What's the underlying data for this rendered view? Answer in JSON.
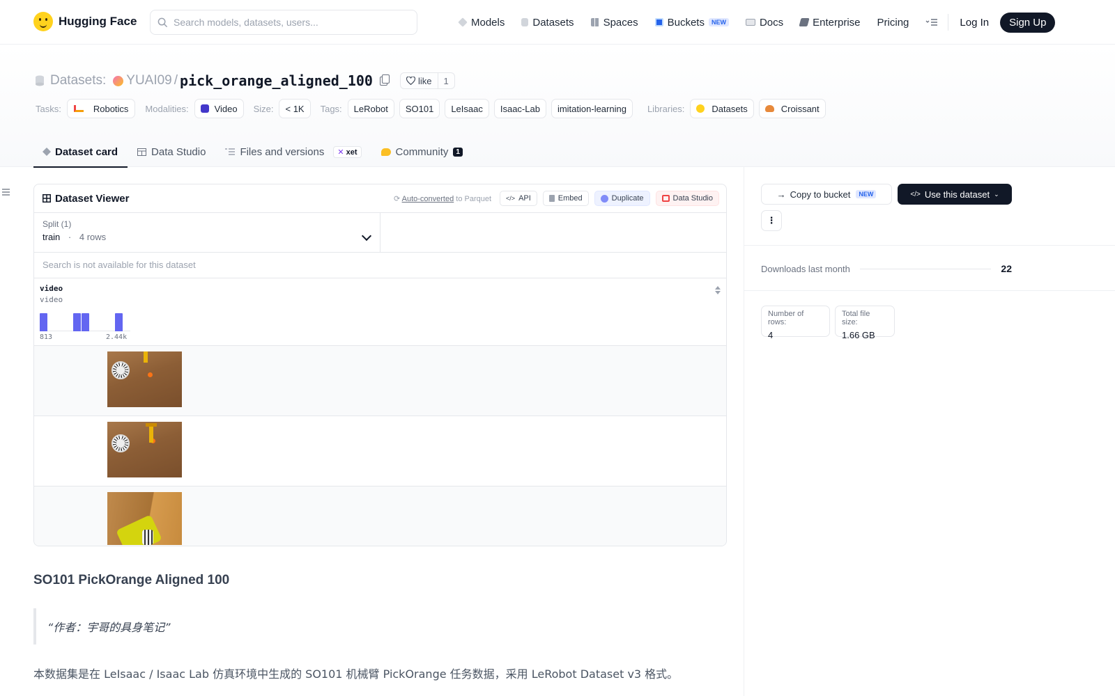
{
  "nav": {
    "brand": "Hugging Face",
    "search_placeholder": "Search models, datasets, users...",
    "links": [
      {
        "label": "Models",
        "icon": "cube-icon",
        "color": "#9ca3af"
      },
      {
        "label": "Datasets",
        "icon": "database-icon",
        "color": "#9ca3af"
      },
      {
        "label": "Spaces",
        "icon": "grid-icon",
        "color": "#9ca3af"
      },
      {
        "label": "Buckets",
        "icon": "bucket-icon",
        "color": "#2563eb",
        "badge": "NEW"
      },
      {
        "label": "Docs",
        "icon": "book-icon",
        "color": "#9ca3af"
      },
      {
        "label": "Enterprise",
        "icon": "enterprise-icon",
        "color": "#374151"
      },
      {
        "label": "Pricing"
      }
    ],
    "login": "Log In",
    "signup": "Sign Up"
  },
  "repo": {
    "type_label": "Datasets:",
    "owner": "YUAI09",
    "separator": "/",
    "name": "pick_orange_aligned_100",
    "like_label": "like",
    "like_count": "1"
  },
  "tags": {
    "tasks_label": "Tasks:",
    "tasks": [
      "Robotics"
    ],
    "modalities_label": "Modalities:",
    "modalities": [
      "Video"
    ],
    "size_label": "Size:",
    "size": [
      "< 1K"
    ],
    "tags_label": "Tags:",
    "tags": [
      "LeRobot",
      "SO101",
      "LeIsaac",
      "Isaac-Lab",
      "imitation-learning"
    ],
    "libraries_label": "Libraries:",
    "libraries": [
      "Datasets",
      "Croissant"
    ]
  },
  "tabs": [
    {
      "label": "Dataset card",
      "active": true
    },
    {
      "label": "Data Studio"
    },
    {
      "label": "Files and versions",
      "badge": "xet"
    },
    {
      "label": "Community",
      "count": "1"
    }
  ],
  "viewer": {
    "title": "Dataset Viewer",
    "auto_converted": "Auto-converted",
    "to_parquet": "to Parquet",
    "buttons": [
      "API",
      "Embed",
      "Duplicate",
      "Data Studio"
    ],
    "split_label": "Split (1)",
    "split_value": "train",
    "split_sep": "·",
    "split_rows": "4 rows",
    "search_na": "Search is not available for this dataset",
    "column": {
      "name": "video",
      "type": "video",
      "hist_min": "813",
      "hist_max": "2.44k",
      "hist_bins": [
        1,
        0,
        0,
        0,
        1,
        1,
        0,
        0,
        0,
        1
      ]
    }
  },
  "readme": {
    "heading": "SO101 PickOrange Aligned 100",
    "quote": "“作者：宇哥的具身笔记”",
    "paragraph": "本数据集是在 LeIsaac / Isaac Lab 仿真环境中生成的 SO101 机械臂 PickOrange 任务数据，采用 LeRobot Dataset v3 格式。"
  },
  "sidebar": {
    "copy_bucket": "Copy to bucket",
    "copy_bucket_badge": "NEW",
    "use_dataset": "Use this dataset",
    "downloads_label": "Downloads last month",
    "downloads_value": "22",
    "rows_label": "Number of rows:",
    "rows_value": "4",
    "size_label": "Total file size:",
    "size_value": "1.66 GB"
  }
}
